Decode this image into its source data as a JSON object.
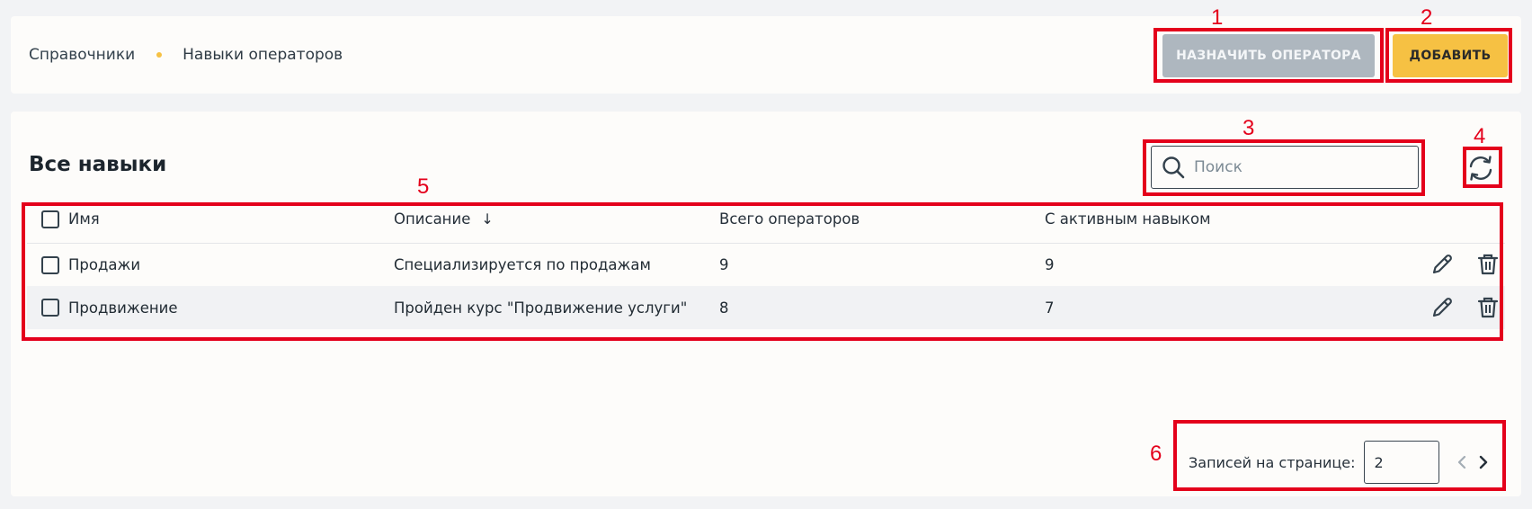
{
  "breadcrumb": {
    "root": "Справочники",
    "current": "Навыки операторов"
  },
  "toolbar": {
    "assign_label": "НАЗНАЧИТЬ ОПЕРАТОРА",
    "add_label": "ДОБАВИТЬ"
  },
  "section": {
    "title": "Все навыки"
  },
  "search": {
    "placeholder": "Поиск",
    "icon": "search-icon"
  },
  "refresh": {
    "icon": "refresh-icon"
  },
  "table": {
    "columns": [
      "Имя",
      "Описание",
      "Всего операторов",
      "С активным навыком"
    ],
    "sort": {
      "column": "Описание",
      "direction": "↓"
    },
    "rows": [
      {
        "name": "Продажи",
        "description": "Специализируется по продажам",
        "total": "9",
        "active": "9"
      },
      {
        "name": "Продвижение",
        "description": "Пройден курс \"Продвижение услуги\"",
        "total": "8",
        "active": "7"
      }
    ]
  },
  "pager": {
    "label": "Записей на странице:",
    "page_size": "2"
  },
  "annotations": [
    "1",
    "2",
    "3",
    "4",
    "5",
    "6"
  ],
  "colors": {
    "accent": "#f6c143",
    "disabled_button": "#aeb7bf",
    "annotation": "#e4001b"
  }
}
